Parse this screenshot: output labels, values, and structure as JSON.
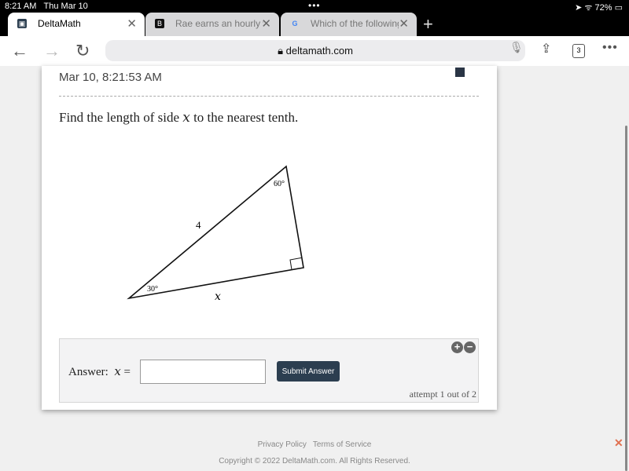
{
  "status_bar": {
    "time": "8:21 AM",
    "date": "Thu Mar 10",
    "battery": "72%"
  },
  "tabs": [
    {
      "title": "DeltaMath",
      "active": true
    },
    {
      "title": "Rae earns an hourly wag",
      "active": false
    },
    {
      "title": "Which of the following se",
      "active": false
    }
  ],
  "toolbar": {
    "url": "deltamath.com",
    "tab_count": "3"
  },
  "problem": {
    "timestamp": "Mar 10, 8:21:53 AM",
    "question_prefix": "Find the length of side ",
    "variable": "x",
    "question_suffix": " to the nearest tenth.",
    "diagram": {
      "angle_top": "60°",
      "angle_left": "30°",
      "hypotenuse": "4",
      "unknown_side": "x"
    }
  },
  "answer": {
    "label": "Answer:",
    "variable": "x",
    "equals": "=",
    "value": "",
    "submit_label": "Submit Answer",
    "attempt": "attempt 1 out of 2"
  },
  "footer": {
    "privacy": "Privacy Policy",
    "terms": "Terms of Service",
    "copyright": "Copyright © 2022 DeltaMath.com. All Rights Reserved."
  }
}
